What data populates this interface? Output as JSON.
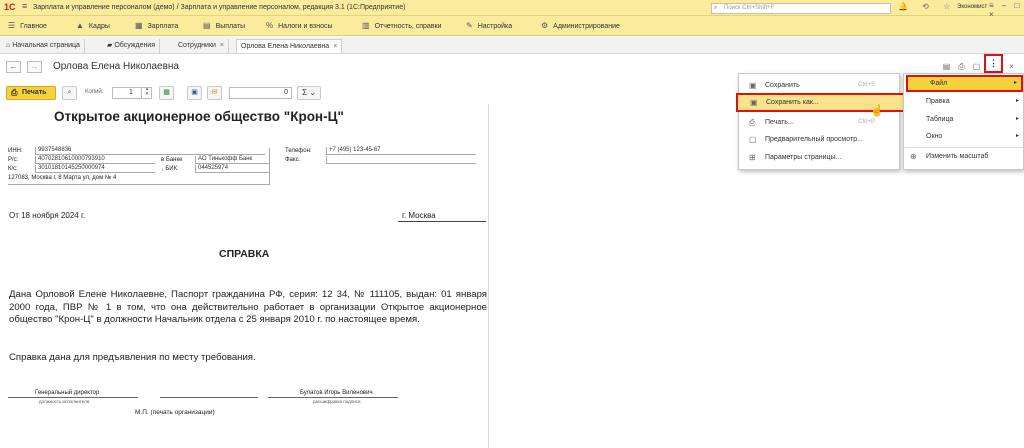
{
  "titlebar": {
    "logo": "1С",
    "menu_icon": "hamburger-icon",
    "title": "Зарплата и управление персоналом (демо) / Зарплата и управление персоналом, редакция 3.1  (1С:Предприятие)",
    "search_placeholder": "Поиск Ctrl+Shift+F",
    "icons": "🔔 ⟲ ☆",
    "user": "Экономист",
    "window_controls": "≡ – □ ×"
  },
  "main_menu": [
    {
      "icon": "home-icon",
      "glyph": "☰",
      "label": "Главное"
    },
    {
      "icon": "staff-icon",
      "glyph": "▲",
      "label": "Кадры"
    },
    {
      "icon": "salary-icon",
      "glyph": "▦",
      "label": "Зарплата"
    },
    {
      "icon": "payments-icon",
      "glyph": "▤",
      "label": "Выплаты"
    },
    {
      "icon": "taxes-icon",
      "glyph": "%",
      "label": "Налоги и взносы"
    },
    {
      "icon": "reports-icon",
      "glyph": "▥",
      "label": "Отчетность, справки"
    },
    {
      "icon": "settings-icon",
      "glyph": "✎",
      "label": "Настройка"
    },
    {
      "icon": "admin-icon",
      "glyph": "⚙",
      "label": "Администрирование"
    }
  ],
  "tabs": [
    {
      "label": "Начальная страница",
      "glyph": "⌂"
    },
    {
      "label": "Обсуждения",
      "glyph": "▰"
    },
    {
      "label": "Сотрудники",
      "close": "×"
    },
    {
      "label": "Орлова Елена Николаевна",
      "close": "×"
    }
  ],
  "form": {
    "back": "←",
    "forward": "→",
    "title": "Орлова Елена Николаевна",
    "more_glyph": "⋮",
    "close": "×"
  },
  "toolbar": {
    "print_label": "Печать",
    "copies_label": "Копий:",
    "copies_value": "1",
    "sum_value": "0",
    "sum_symbol": "Σ ⌄"
  },
  "document": {
    "org_name": "Открытое акционерное общество \"Крон-Ц\"",
    "inn_label": "ИНН:",
    "inn": "9937548836",
    "rs_label": "Р/с:",
    "rs": "40702810610000793910",
    "ks_label": "К/с:",
    "ks": "30101810145250000974",
    "address": "127083, Москва г, 8 Марта ул, дом № 4",
    "bank_label": "в Банке",
    "bank": "АО Тинькофф Банк",
    "bik_label": ", БИК:",
    "bik": "044525974",
    "phone_label": "Телефон:",
    "phone": "+7 (495) 123-45-67",
    "fax_label": "Факс:",
    "date": "От 18 ноября 2024 г.",
    "city": "г. Москва",
    "heading": "СПРАВКА",
    "body": "Дана Орловой Елене Николаевне, Паспорт гражданина РФ, серия: 12 34, № 111105, выдан: 01 января 2000 года, ПВР № 1 в том, что она действительно работает в организации Открытое акционерное общество \"Крон-Ц\" в должности Начальник отдела с 25 января 2010 г. по настоящее время.",
    "purpose": "Справка дана для предъявления по месту требования.",
    "director_title": "Генеральный директор",
    "position_caption": "должность исполнителя",
    "director_name": "Булатов Игорь Виленович",
    "signature_caption": "расшифровка подписи",
    "stamp": "М.П. (печать организации)"
  },
  "menu_left": [
    {
      "icon": "save-icon",
      "glyph": "▣",
      "label": "Сохранить",
      "shortcut": "Ctrl+S"
    },
    {
      "icon": "save-as-icon",
      "glyph": "▣",
      "label": "Сохранить как...",
      "shortcut": ""
    },
    {
      "icon": "print-icon",
      "glyph": "⎙",
      "label": "Печать...",
      "shortcut": "Ctrl+P"
    },
    {
      "icon": "preview-icon",
      "glyph": "▢",
      "label": "Предварительный просмотр...",
      "shortcut": ""
    },
    {
      "icon": "page-settings-icon",
      "glyph": "⊞",
      "label": "Параметры страницы...",
      "shortcut": ""
    }
  ],
  "menu_right": [
    {
      "label": "Файл",
      "arrow": "▸"
    },
    {
      "label": "Правка",
      "arrow": "▸"
    },
    {
      "label": "Таблица",
      "arrow": "▸"
    },
    {
      "label": "Окно",
      "arrow": "▸"
    },
    {
      "label": "Изменить масштаб",
      "glyph": "⊕"
    }
  ],
  "colors": {
    "accent": "#f7d03d",
    "highlight_border": "#e01010",
    "menubar": "#fbeb9d"
  }
}
